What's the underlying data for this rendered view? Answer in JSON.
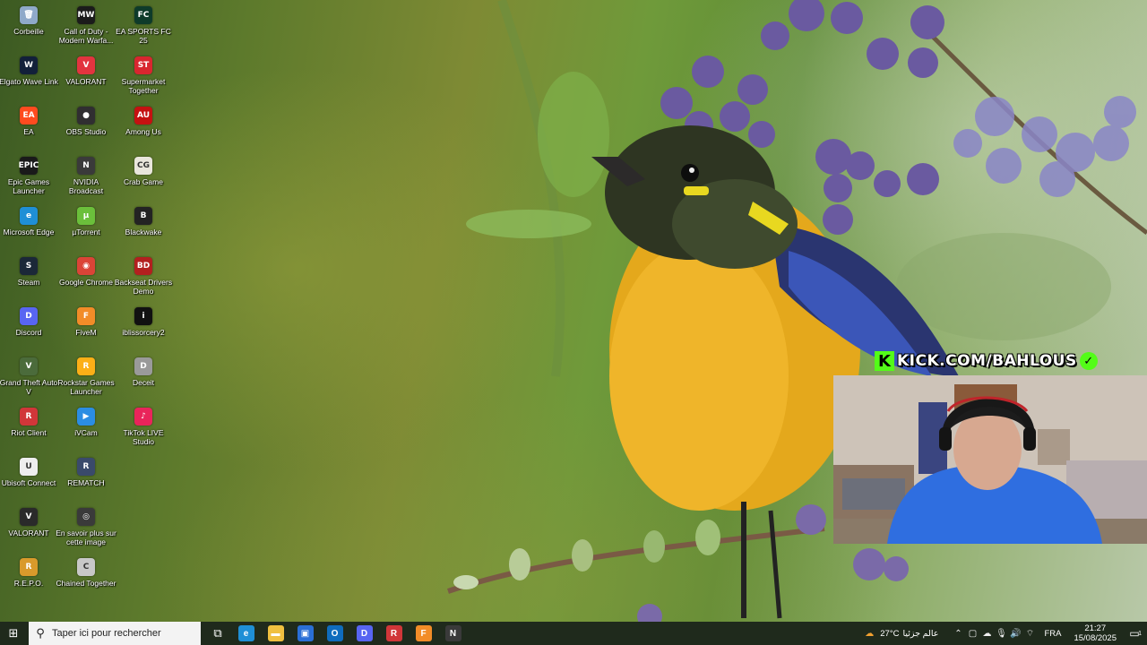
{
  "desktop": {
    "icons": [
      {
        "label": "Corbeille",
        "glyph": "🗑",
        "color": "#8fa9c9",
        "col": 0,
        "row": 0
      },
      {
        "label": "Call of Duty - Modern Warfa...",
        "glyph": "MW",
        "color": "#1b1b1b",
        "col": 1,
        "row": 0
      },
      {
        "label": "EA SPORTS FC 25",
        "glyph": "FC",
        "color": "#0e3b2a",
        "col": 2,
        "row": 0
      },
      {
        "label": "Elgato Wave Link",
        "glyph": "W",
        "color": "#12203a",
        "col": 0,
        "row": 1
      },
      {
        "label": "VALORANT",
        "glyph": "V",
        "color": "#e2343f",
        "col": 1,
        "row": 1
      },
      {
        "label": "Supermarket Together",
        "glyph": "ST",
        "color": "#d8262f",
        "col": 2,
        "row": 1
      },
      {
        "label": "EA",
        "glyph": "EA",
        "color": "#ff4b1f",
        "col": 0,
        "row": 2
      },
      {
        "label": "OBS Studio",
        "glyph": "●",
        "color": "#302e31",
        "col": 1,
        "row": 2
      },
      {
        "label": "Among Us",
        "glyph": "AU",
        "color": "#c51111",
        "col": 2,
        "row": 2
      },
      {
        "label": "Epic Games Launcher",
        "glyph": "EPIC",
        "color": "#1a1a1a",
        "col": 0,
        "row": 3
      },
      {
        "label": "NVIDIA Broadcast",
        "glyph": "N",
        "color": "#3a3a3a",
        "col": 1,
        "row": 3
      },
      {
        "label": "Crab Game",
        "glyph": "CG",
        "color": "#e9e6dc",
        "col": 2,
        "row": 3
      },
      {
        "label": "Microsoft Edge",
        "glyph": "e",
        "color": "#1f8fd6",
        "col": 0,
        "row": 4
      },
      {
        "label": "µTorrent",
        "glyph": "µ",
        "color": "#6bbf3b",
        "col": 1,
        "row": 4
      },
      {
        "label": "Blackwake",
        "glyph": "B",
        "color": "#232323",
        "col": 2,
        "row": 4
      },
      {
        "label": "Steam",
        "glyph": "S",
        "color": "#1b2838",
        "col": 0,
        "row": 5
      },
      {
        "label": "Google Chrome",
        "glyph": "◉",
        "color": "#db4437",
        "col": 1,
        "row": 5
      },
      {
        "label": "Backseat Drivers Demo",
        "glyph": "BD",
        "color": "#b3201f",
        "col": 2,
        "row": 5
      },
      {
        "label": "Discord",
        "glyph": "D",
        "color": "#5865f2",
        "col": 0,
        "row": 6
      },
      {
        "label": "FiveM",
        "glyph": "F",
        "color": "#f28c28",
        "col": 1,
        "row": 6
      },
      {
        "label": "iblissorcery2",
        "glyph": "i",
        "color": "#111111",
        "col": 2,
        "row": 6
      },
      {
        "label": "Grand Theft Auto V",
        "glyph": "V",
        "color": "#4b6b3b",
        "col": 0,
        "row": 7
      },
      {
        "label": "Rockstar Games Launcher",
        "glyph": "R",
        "color": "#fcaf17",
        "col": 1,
        "row": 7
      },
      {
        "label": "Deceit",
        "glyph": "D",
        "color": "#9a9a9a",
        "col": 2,
        "row": 7
      },
      {
        "label": "Riot Client",
        "glyph": "R",
        "color": "#d13639",
        "col": 0,
        "row": 8
      },
      {
        "label": "iVCam",
        "glyph": "▶",
        "color": "#2b8de3",
        "col": 1,
        "row": 8
      },
      {
        "label": "TikTok LIVE Studio",
        "glyph": "♪",
        "color": "#e9245a",
        "col": 2,
        "row": 8
      },
      {
        "label": "Ubisoft Connect",
        "glyph": "U",
        "color": "#eeeeee",
        "col": 0,
        "row": 9
      },
      {
        "label": "REMATCH",
        "glyph": "R",
        "color": "#3a4a6b",
        "col": 1,
        "row": 9
      },
      {
        "label": "VALORANT",
        "glyph": "V",
        "color": "#2a2a2a",
        "col": 0,
        "row": 10
      },
      {
        "label": "En savoir plus sur cette image",
        "glyph": "◎",
        "color": "#3a3a3a",
        "col": 1,
        "row": 10
      },
      {
        "label": "R.E.P.O.",
        "glyph": "R",
        "color": "#d99a2b",
        "col": 0,
        "row": 11
      },
      {
        "label": "Chained Together",
        "glyph": "C",
        "color": "#c8c8c8",
        "col": 1,
        "row": 11
      }
    ]
  },
  "overlay": {
    "kick_url": "KICK.COM/BAHLOUS",
    "kick_letter": "K",
    "badge_glyph": "✓"
  },
  "taskbar": {
    "start_glyph": "⊞",
    "search_glyph": "⚲",
    "search_placeholder": "Taper ici pour rechercher",
    "task_view_glyph": "⧉",
    "apps": [
      {
        "name": "edge-app",
        "glyph": "e",
        "color": "#1f8fd6"
      },
      {
        "name": "file-explorer-app",
        "glyph": "▬",
        "color": "#f0c040"
      },
      {
        "name": "store-app",
        "glyph": "▣",
        "color": "#2a6fd6"
      },
      {
        "name": "outlook-app",
        "glyph": "O",
        "color": "#0f6cbd"
      },
      {
        "name": "discord-app",
        "glyph": "D",
        "color": "#5865f2"
      },
      {
        "name": "riot-app",
        "glyph": "R",
        "color": "#d13639"
      },
      {
        "name": "fivem-app",
        "glyph": "F",
        "color": "#f28c28"
      },
      {
        "name": "nvidia-app",
        "glyph": "N",
        "color": "#3a3a3a"
      }
    ],
    "weather": {
      "temp": "27°C",
      "desc": "عالم جزئيا"
    },
    "language": "FRA",
    "time": "21:27",
    "date": "15/08/2025",
    "notification_count": "1"
  }
}
